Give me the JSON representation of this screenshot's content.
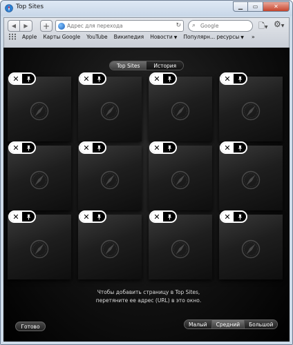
{
  "window": {
    "title": "Top Sites"
  },
  "toolbar": {
    "url_placeholder": "Адрес для перехода",
    "search_placeholder": "Google"
  },
  "bookmarks": [
    {
      "label": "Apple",
      "menu": false
    },
    {
      "label": "Карты Google",
      "menu": false
    },
    {
      "label": "YouTube",
      "menu": false
    },
    {
      "label": "Википедия",
      "menu": false
    },
    {
      "label": "Новости",
      "menu": true
    },
    {
      "label": "Популярн... ресурсы",
      "menu": true
    }
  ],
  "topsites": {
    "tabs": [
      "Top Sites",
      "История"
    ],
    "active_tab": "Top Sites",
    "hint_line1": "Чтобы добавить страницу в Top Sites,",
    "hint_line2": "перетяните ее адрес (URL) в это окно.",
    "done_label": "Готово",
    "sizes": [
      "Малый",
      "Средний",
      "Большой"
    ],
    "active_size": "Средний"
  }
}
